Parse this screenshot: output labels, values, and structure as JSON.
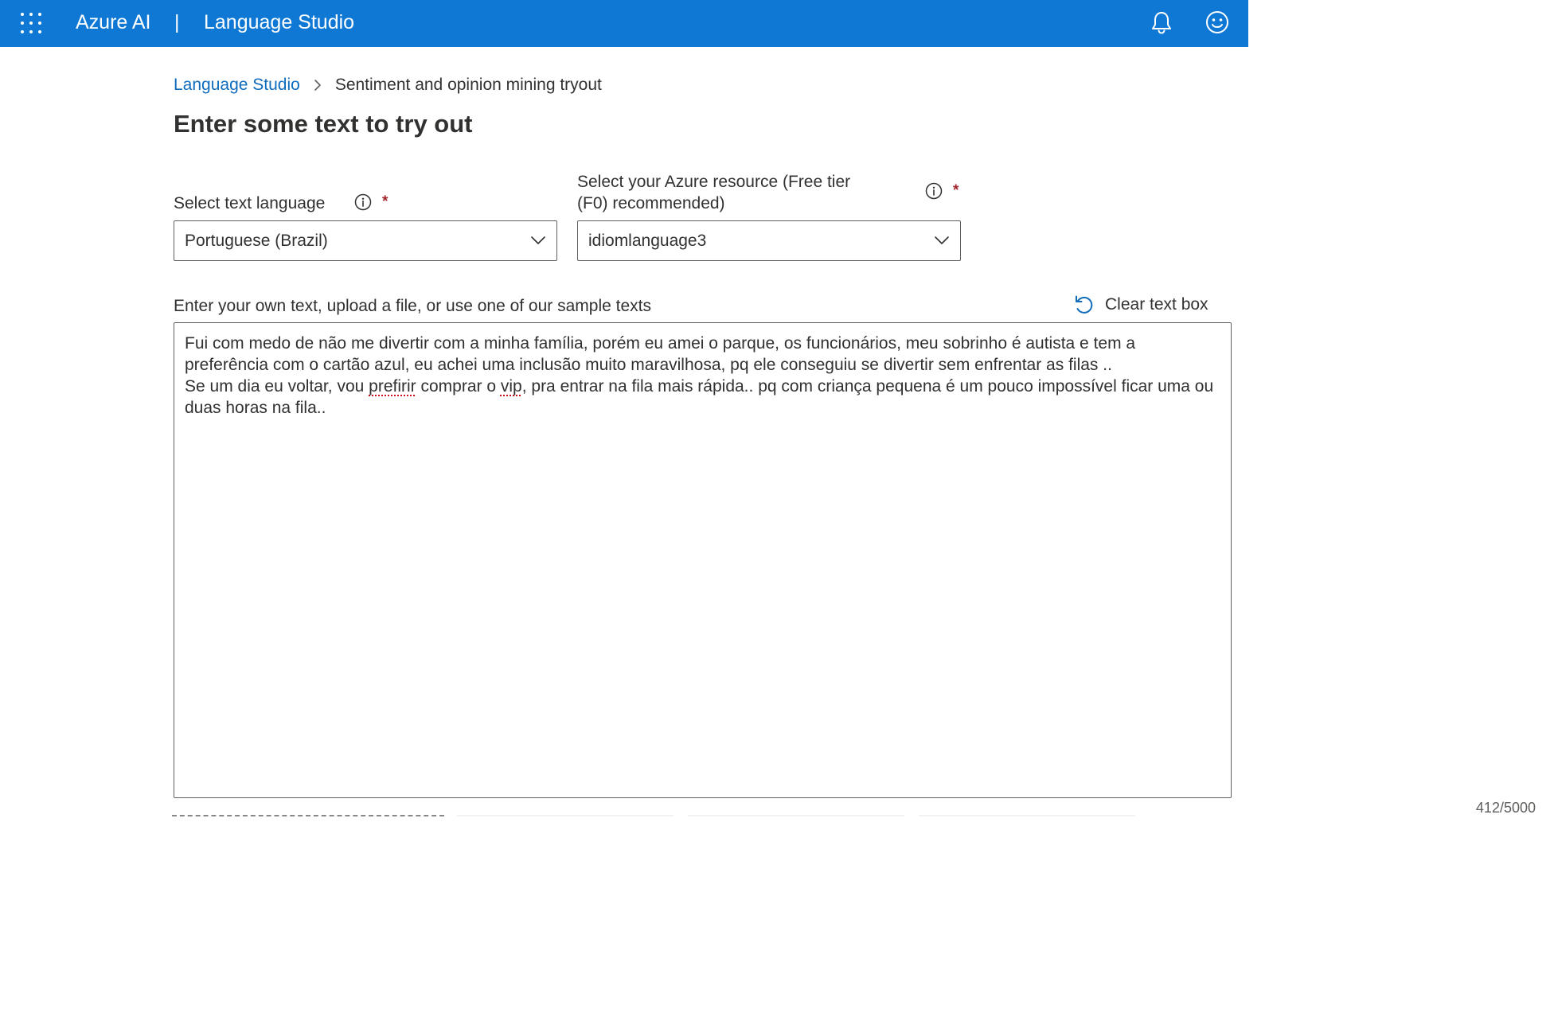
{
  "topbar": {
    "waffle_icon": "app-launcher-icon",
    "brand": "Azure AI",
    "separator": "|",
    "product": "Language Studio",
    "notification_icon": "bell-icon",
    "feedback_icon": "smiley-icon",
    "background_color": "#0f78d4"
  },
  "breadcrumb": {
    "root": "Language Studio",
    "current": "Sentiment and opinion mining tryout"
  },
  "page": {
    "title": "Enter some text to try out"
  },
  "language_select": {
    "label": "Select text language",
    "required_mark": "*",
    "value": "Portuguese (Brazil)"
  },
  "resource_select": {
    "label_line1": "Select your Azure resource (Free tier",
    "label_line2": "(F0) recommended)",
    "required_mark": "*",
    "value": "idiomlanguage3"
  },
  "text_input": {
    "label": "Enter your own text, upload a file, or use one of our sample texts",
    "clear_button": "Clear text box",
    "para1": "Fui com medo de não me divertir com a minha família, porém eu amei o parque, os funcionários, meu sobrinho é autista e tem a preferência com o cartão azul, eu achei uma inclusão muito maravilhosa, pq ele conseguiu se divertir sem enfrentar as filas ..",
    "para2_a": "Se um dia eu voltar, vou ",
    "para2_misspelled1": "prefirir",
    "para2_b": " comprar o ",
    "para2_misspelled2": "vip",
    "para2_c": ", pra entrar na fila mais rápida.. pq com criança pequena é um pouco impossível ficar uma ou duas horas na fila..",
    "char_count": "412/5000"
  }
}
